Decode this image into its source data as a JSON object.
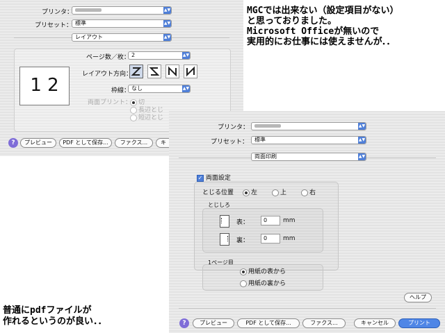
{
  "dialog1": {
    "printer_label": "プリンタ：",
    "preset_label": "プリセット：",
    "preset_value": "標準",
    "panel_value": "レイアウト",
    "preview_text": "1 2",
    "pages_label": "ページ数／枚：",
    "pages_value": "2",
    "direction_label": "レイアウト方向：",
    "border_label": "枠線：",
    "border_value": "なし",
    "duplex_label": "両面プリント：",
    "duplex_options": [
      "切",
      "長辺とじ",
      "短辺とじ"
    ],
    "buttons": {
      "preview": "プレビュー",
      "pdf": "PDF として保存...",
      "fax": "ファクス...",
      "cut": "キ"
    }
  },
  "dialog2": {
    "printer_label": "プリンタ：",
    "preset_label": "プリセット：",
    "preset_value": "標準",
    "panel_value": "両面印刷",
    "duplex_check_label": "両面設定",
    "binding_label": "とじる位置",
    "binding_options": [
      "左",
      "上",
      "右"
    ],
    "margin_group_label": "とじしろ",
    "front_label": "表：",
    "front_value": "0",
    "back_label": "裏：",
    "back_value": "0",
    "unit": "mm",
    "first_page_label": "1ページ目",
    "first_page_options": [
      "用紙の表から",
      "用紙の裏から"
    ],
    "help_button": "ヘルプ",
    "buttons": {
      "preview": "プレビュー",
      "pdf": "PDF として保存...",
      "fax": "ファクス...",
      "cancel": "キャンセル",
      "print": "プリント"
    }
  },
  "notes": {
    "top": [
      "MGCでは出来ない（設定項目がない）",
      "と思っておりました。",
      "Microsoft Officeが無いので",
      "実用的にお仕事には使えませんが．．"
    ],
    "bottom": [
      "普通にpdfファイルが",
      "作れるというのが良い．．"
    ]
  },
  "colors": {
    "accent": "#4f86e6",
    "help": "#7f6dd8"
  }
}
